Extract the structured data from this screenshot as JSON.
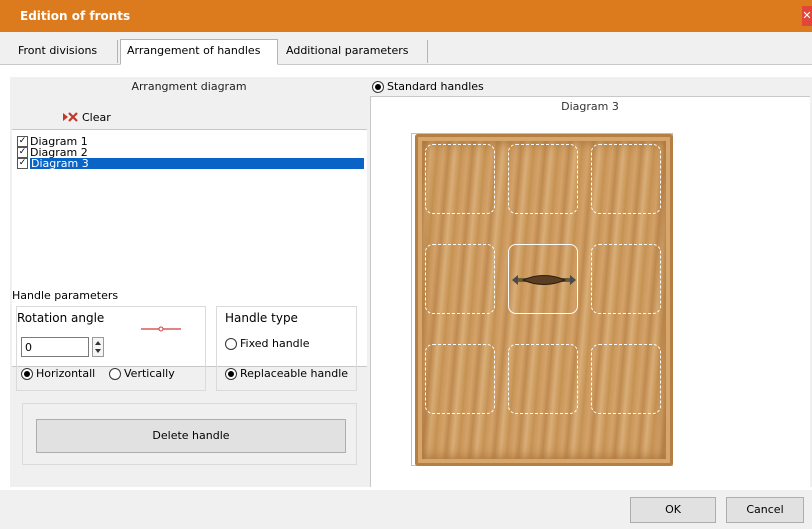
{
  "window": {
    "title": "Edition of fronts",
    "close_label": "✕"
  },
  "tabs": [
    {
      "label": "Front divisions",
      "active": false
    },
    {
      "label": "Arrangement of handles",
      "active": true
    },
    {
      "label": "Additional parameters",
      "active": false
    }
  ],
  "left": {
    "header": "Arrangment diagram",
    "clear_label": "Clear",
    "diagrams": [
      {
        "label": "Diagram 1",
        "checked": true,
        "selected": false
      },
      {
        "label": "Diagram 2",
        "checked": true,
        "selected": false
      },
      {
        "label": "Diagram 3",
        "checked": true,
        "selected": true
      }
    ],
    "handle_params": {
      "title": "Handle parameters",
      "rotation_title": "Rotation angle",
      "rotation_value": "0",
      "horizontal_label": "Horizontall",
      "vertical_label": "Vertically",
      "orientation": "horizontal",
      "type_title": "Handle type",
      "fixed_label": "Fixed handle",
      "replaceable_label": "Replaceable handle",
      "type": "replaceable",
      "delete_label": "Delete handle"
    }
  },
  "right": {
    "standard_label": "Standard handles",
    "diagram_title": "Diagram 3"
  },
  "footer": {
    "ok_label": "OK",
    "cancel_label": "Cancel"
  },
  "colors": {
    "titlebar": "#dc7a1e",
    "selection": "#0a64c8",
    "door_wood": "#c89458"
  }
}
